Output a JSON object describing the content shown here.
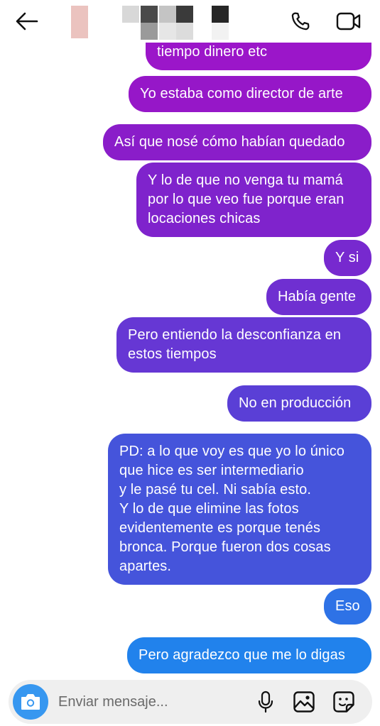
{
  "header": {
    "back_icon": "arrow-left-icon",
    "call_icon": "phone-icon",
    "video_icon": "video-camera-icon"
  },
  "messages": [
    {
      "text": "tiempo dinero etc",
      "color": "#9b16c9"
    },
    {
      "text": "Yo estaba como director de arte",
      "color": "#9617c8"
    },
    {
      "text": "Así que nosé cómo habían quedado",
      "color": "#8a1dc9"
    },
    {
      "text": "Y lo de que no venga tu mamá\npor lo que veo fue porque eran\nlocaciones chicas",
      "color": "#7f23cc"
    },
    {
      "text": "Y si",
      "color": "#7729cf"
    },
    {
      "text": "Había gente",
      "color": "#6f2fd1"
    },
    {
      "text": "Pero entiendo la desconfianza en\nestos tiempos",
      "color": "#6637d4"
    },
    {
      "text": "No en producción",
      "color": "#5a3fd6"
    },
    {
      "text": "PD: a lo que voy es que yo lo único\nque hice es ser intermediario\ny le pasé tu cel. Ni sabía esto.\nY lo de que elimine las fotos\nevidentemente es porque tenés\nbronca. Porque fueron dos cosas\napartes.",
      "color": "#4554db"
    },
    {
      "text": "Eso",
      "color": "#2e72e6"
    },
    {
      "text": "Pero agradezco que me lo digas",
      "color": "#2182ec"
    }
  ],
  "composer": {
    "placeholder": "Enviar mensaje...",
    "value": "",
    "camera_icon": "camera-icon",
    "mic_icon": "microphone-icon",
    "gallery_icon": "image-icon",
    "sticker_icon": "sticker-icon",
    "accent_color": "#3797f0"
  }
}
